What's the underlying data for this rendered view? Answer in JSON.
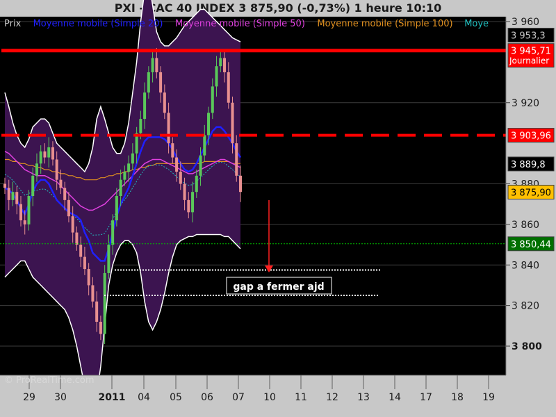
{
  "header": {
    "title": "PXI - CAC 40 INDEX     3 875,90 (-0,73%)     1 heure  10:10"
  },
  "legend": [
    {
      "label": "Prix",
      "color": "#c8c8c8"
    },
    {
      "label": "Moyenne mobile (Simple 20)",
      "color": "#2020ff"
    },
    {
      "label": "Moyenne mobile (Simple 50)",
      "color": "#e040e0"
    },
    {
      "label": "Moyenne mobile (Simple 100)",
      "color": "#e09020"
    },
    {
      "label": "Moye",
      "color": "#20c0c0"
    }
  ],
  "watermark": "© ProRealTime.com",
  "annotation": {
    "text": "gap a fermer ajd"
  },
  "colors": {
    "background": "#000000",
    "bollinger_fill": "#3c1450",
    "up_candle": "#5ac85a",
    "down_candle": "#e89090",
    "resistance": "#ff0000",
    "ma20": "#2020ff",
    "ma50": "#e040e0",
    "ma100": "#e09020",
    "ma_cyan": "#20c0c0"
  },
  "chart_data": {
    "type": "candlestick",
    "instrument": "CAC 40 INDEX",
    "timeframe": "1 heure",
    "x_ticks": [
      "29",
      "30",
      "2011",
      "04",
      "05",
      "06",
      "07",
      "10",
      "11",
      "12",
      "13",
      "14",
      "17",
      "18",
      "19"
    ],
    "y_ticks": [
      3960,
      3920,
      3880,
      3860,
      3840,
      3820,
      3800
    ],
    "y_tick_labels": [
      "3 960",
      "3 920",
      "3 880",
      "3 860",
      "3 840",
      "3 820",
      "3 800"
    ],
    "ylim": [
      3788,
      3963
    ],
    "price_labels": [
      {
        "value": "3 953,3",
        "y": 3953.3,
        "bg": "#000000",
        "fg": "#c8c8c8"
      },
      {
        "value": "3 945,71",
        "sub": "Journalier",
        "y": 3945.71,
        "bg": "#ff0000",
        "fg": "#ffffff"
      },
      {
        "value": "3 903,96",
        "y": 3903.96,
        "bg": "#ff0000",
        "fg": "#ffffff"
      },
      {
        "value": "3 889,8",
        "y": 3889.8,
        "bg": "#000000",
        "fg": "#ffffff"
      },
      {
        "value": "3 875,90",
        "y": 3875.9,
        "bg": "#ffc000",
        "fg": "#000000"
      },
      {
        "value": "3 850,44",
        "y": 3850.44,
        "bg": "#007000",
        "fg": "#ffffff"
      }
    ],
    "horizontal_lines": [
      {
        "name": "resistance-daily",
        "y": 3945.71,
        "style": "solid",
        "color": "#ff0000"
      },
      {
        "name": "resistance-dashed",
        "y": 3903.96,
        "style": "dashed",
        "color": "#ff0000"
      },
      {
        "name": "support-dotted",
        "y": 3850.44,
        "style": "dotted",
        "color": "#00c000"
      },
      {
        "name": "gap-upper",
        "y": 3837.5,
        "style": "dotted",
        "color": "#ffffff"
      },
      {
        "name": "gap-lower",
        "y": 3825,
        "style": "dotted",
        "color": "#ffffff"
      }
    ],
    "closes": [
      3878,
      3872,
      3876,
      3870,
      3862,
      3860,
      3874,
      3884,
      3890,
      3896,
      3893,
      3898,
      3892,
      3882,
      3878,
      3872,
      3864,
      3856,
      3850,
      3844,
      3838,
      3830,
      3822,
      3812,
      3806,
      3836,
      3850,
      3862,
      3874,
      3882,
      3886,
      3890,
      3895,
      3905,
      3912,
      3925,
      3935,
      3942,
      3935,
      3925,
      3915,
      3900,
      3893,
      3886,
      3880,
      3872,
      3866,
      3876,
      3884,
      3894,
      3904,
      3915,
      3928,
      3938,
      3942,
      3935,
      3920,
      3900,
      3884,
      3876
    ],
    "ma20": [
      3878,
      3877,
      3875,
      3872,
      3868,
      3865,
      3870,
      3876,
      3880,
      3882,
      3882,
      3880,
      3876,
      3872,
      3870,
      3868,
      3866,
      3865,
      3864,
      3862,
      3856,
      3852,
      3846,
      3844,
      3842,
      3842,
      3848,
      3856,
      3864,
      3870,
      3874,
      3878,
      3884,
      3890,
      3896,
      3901,
      3903,
      3903,
      3903,
      3903,
      3902,
      3900,
      3897,
      3893,
      3890,
      3887,
      3886,
      3887,
      3890,
      3894,
      3898,
      3902,
      3906,
      3908,
      3908,
      3906,
      3903,
      3900,
      3896,
      3893
    ],
    "ma50": [
      3896,
      3895,
      3893,
      3891,
      3889,
      3887,
      3886,
      3885,
      3884,
      3884,
      3884,
      3883,
      3882,
      3881,
      3879,
      3877,
      3875,
      3873,
      3871,
      3869,
      3868,
      3867,
      3867,
      3868,
      3869,
      3870,
      3872,
      3874,
      3876,
      3878,
      3880,
      3882,
      3884,
      3886,
      3888,
      3890,
      3891,
      3892,
      3892,
      3892,
      3891,
      3890,
      3889,
      3888,
      3887,
      3886,
      3885,
      3885,
      3886,
      3887,
      3888,
      3889,
      3890,
      3891,
      3892,
      3892,
      3891,
      3890,
      3889,
      3888
    ],
    "ma100": [
      3892,
      3892,
      3891,
      3891,
      3890,
      3890,
      3889,
      3889,
      3888,
      3888,
      3887,
      3887,
      3886,
      3886,
      3885,
      3885,
      3884,
      3884,
      3883,
      3883,
      3882,
      3882,
      3882,
      3882,
      3883,
      3883,
      3884,
      3884,
      3885,
      3885,
      3886,
      3886,
      3887,
      3887,
      3888,
      3888,
      3889,
      3889,
      3890,
      3890,
      3890,
      3890,
      3890,
      3890,
      3890,
      3890,
      3890,
      3890,
      3890,
      3890,
      3891,
      3891,
      3891,
      3891,
      3891,
      3891,
      3891,
      3890,
      3890,
      3890
    ],
    "bb_upper": [
      3925,
      3918,
      3910,
      3904,
      3900,
      3898,
      3902,
      3908,
      3910,
      3912,
      3912,
      3910,
      3905,
      3900,
      3898,
      3896,
      3894,
      3892,
      3890,
      3888,
      3886,
      3890,
      3898,
      3912,
      3918,
      3912,
      3905,
      3898,
      3895,
      3895,
      3900,
      3910,
      3925,
      3940,
      3960,
      3975,
      3980,
      3968,
      3955,
      3950,
      3948,
      3948,
      3950,
      3952,
      3955,
      3958,
      3960,
      3962,
      3964,
      3966,
      3966,
      3964,
      3962,
      3960,
      3958,
      3956,
      3954,
      3952,
      3951,
      3950
    ],
    "bb_lower": [
      3834,
      3836,
      3838,
      3840,
      3842,
      3842,
      3838,
      3834,
      3832,
      3830,
      3828,
      3826,
      3824,
      3822,
      3820,
      3818,
      3814,
      3808,
      3800,
      3790,
      3780,
      3774,
      3770,
      3776,
      3790,
      3810,
      3830,
      3840,
      3846,
      3850,
      3852,
      3852,
      3850,
      3846,
      3836,
      3822,
      3812,
      3808,
      3812,
      3818,
      3826,
      3836,
      3844,
      3850,
      3852,
      3853,
      3854,
      3854,
      3855,
      3855,
      3855,
      3855,
      3855,
      3855,
      3855,
      3854,
      3854,
      3852,
      3850,
      3848
    ]
  }
}
